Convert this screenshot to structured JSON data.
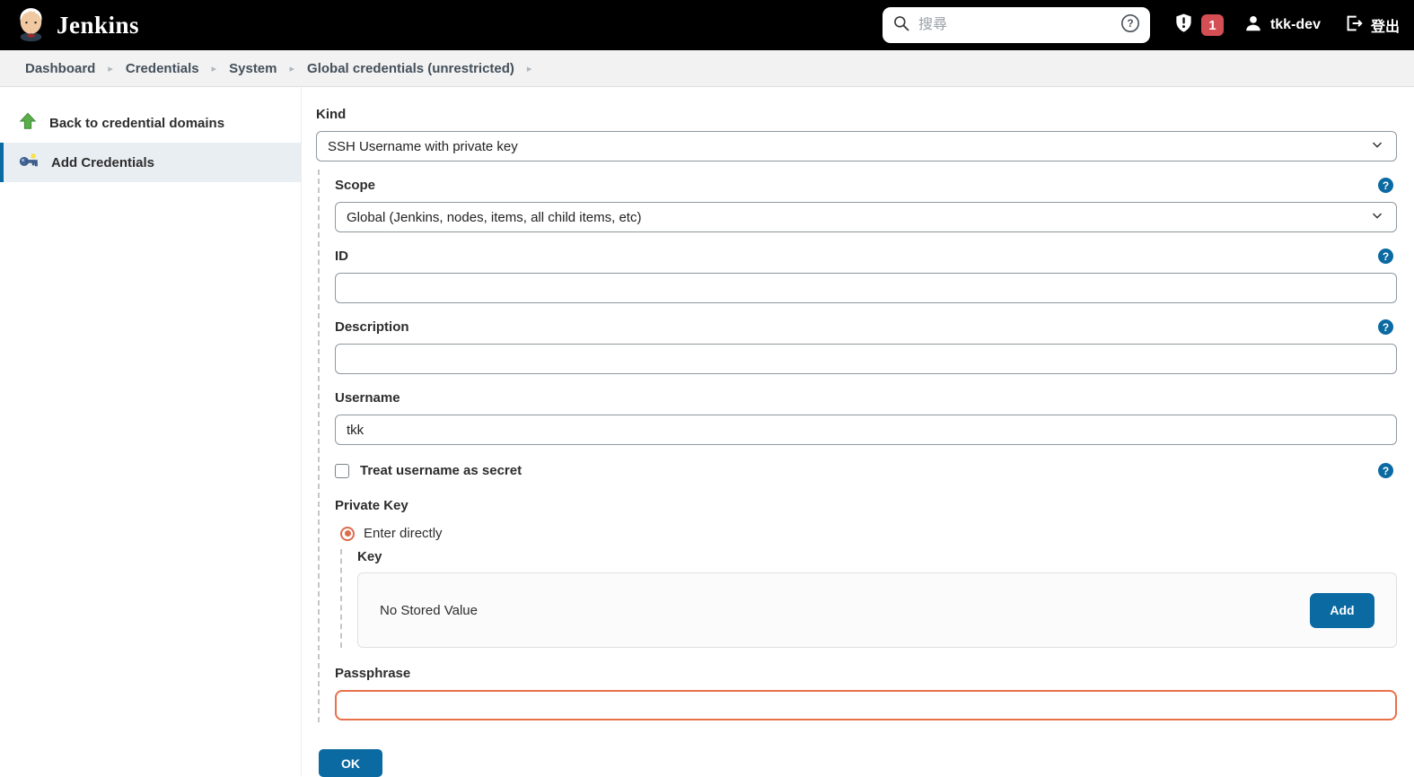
{
  "header": {
    "brand": "Jenkins",
    "search": {
      "placeholder": "搜尋"
    },
    "security_badge_count": "1",
    "user_name": "tkk-dev",
    "logout_label": "登出"
  },
  "breadcrumb": {
    "items": [
      "Dashboard",
      "Credentials",
      "System",
      "Global credentials (unrestricted)"
    ]
  },
  "sidebar": {
    "back_label": "Back to credential domains",
    "add_label": "Add Credentials"
  },
  "form": {
    "kind": {
      "label": "Kind",
      "value": "SSH Username with private key"
    },
    "scope": {
      "label": "Scope",
      "value": "Global (Jenkins, nodes, items, all child items, etc)"
    },
    "id": {
      "label": "ID",
      "value": ""
    },
    "description": {
      "label": "Description",
      "value": ""
    },
    "username": {
      "label": "Username",
      "value": "tkk"
    },
    "treat_secret": {
      "label": "Treat username as secret",
      "checked": false
    },
    "private_key": {
      "label": "Private Key",
      "radio_label": "Enter directly",
      "radio_selected": true
    },
    "key": {
      "label": "Key",
      "empty_text": "No Stored Value",
      "add_button": "Add"
    },
    "passphrase": {
      "label": "Passphrase",
      "value": ""
    },
    "ok_button": "OK"
  },
  "colors": {
    "accent": "#0b6aa2",
    "badge_red": "#d54e53",
    "focus_orange": "#e8714a",
    "radio_orange": "#dd6b4d",
    "sidebar_selected_bg": "#e9eef2"
  }
}
